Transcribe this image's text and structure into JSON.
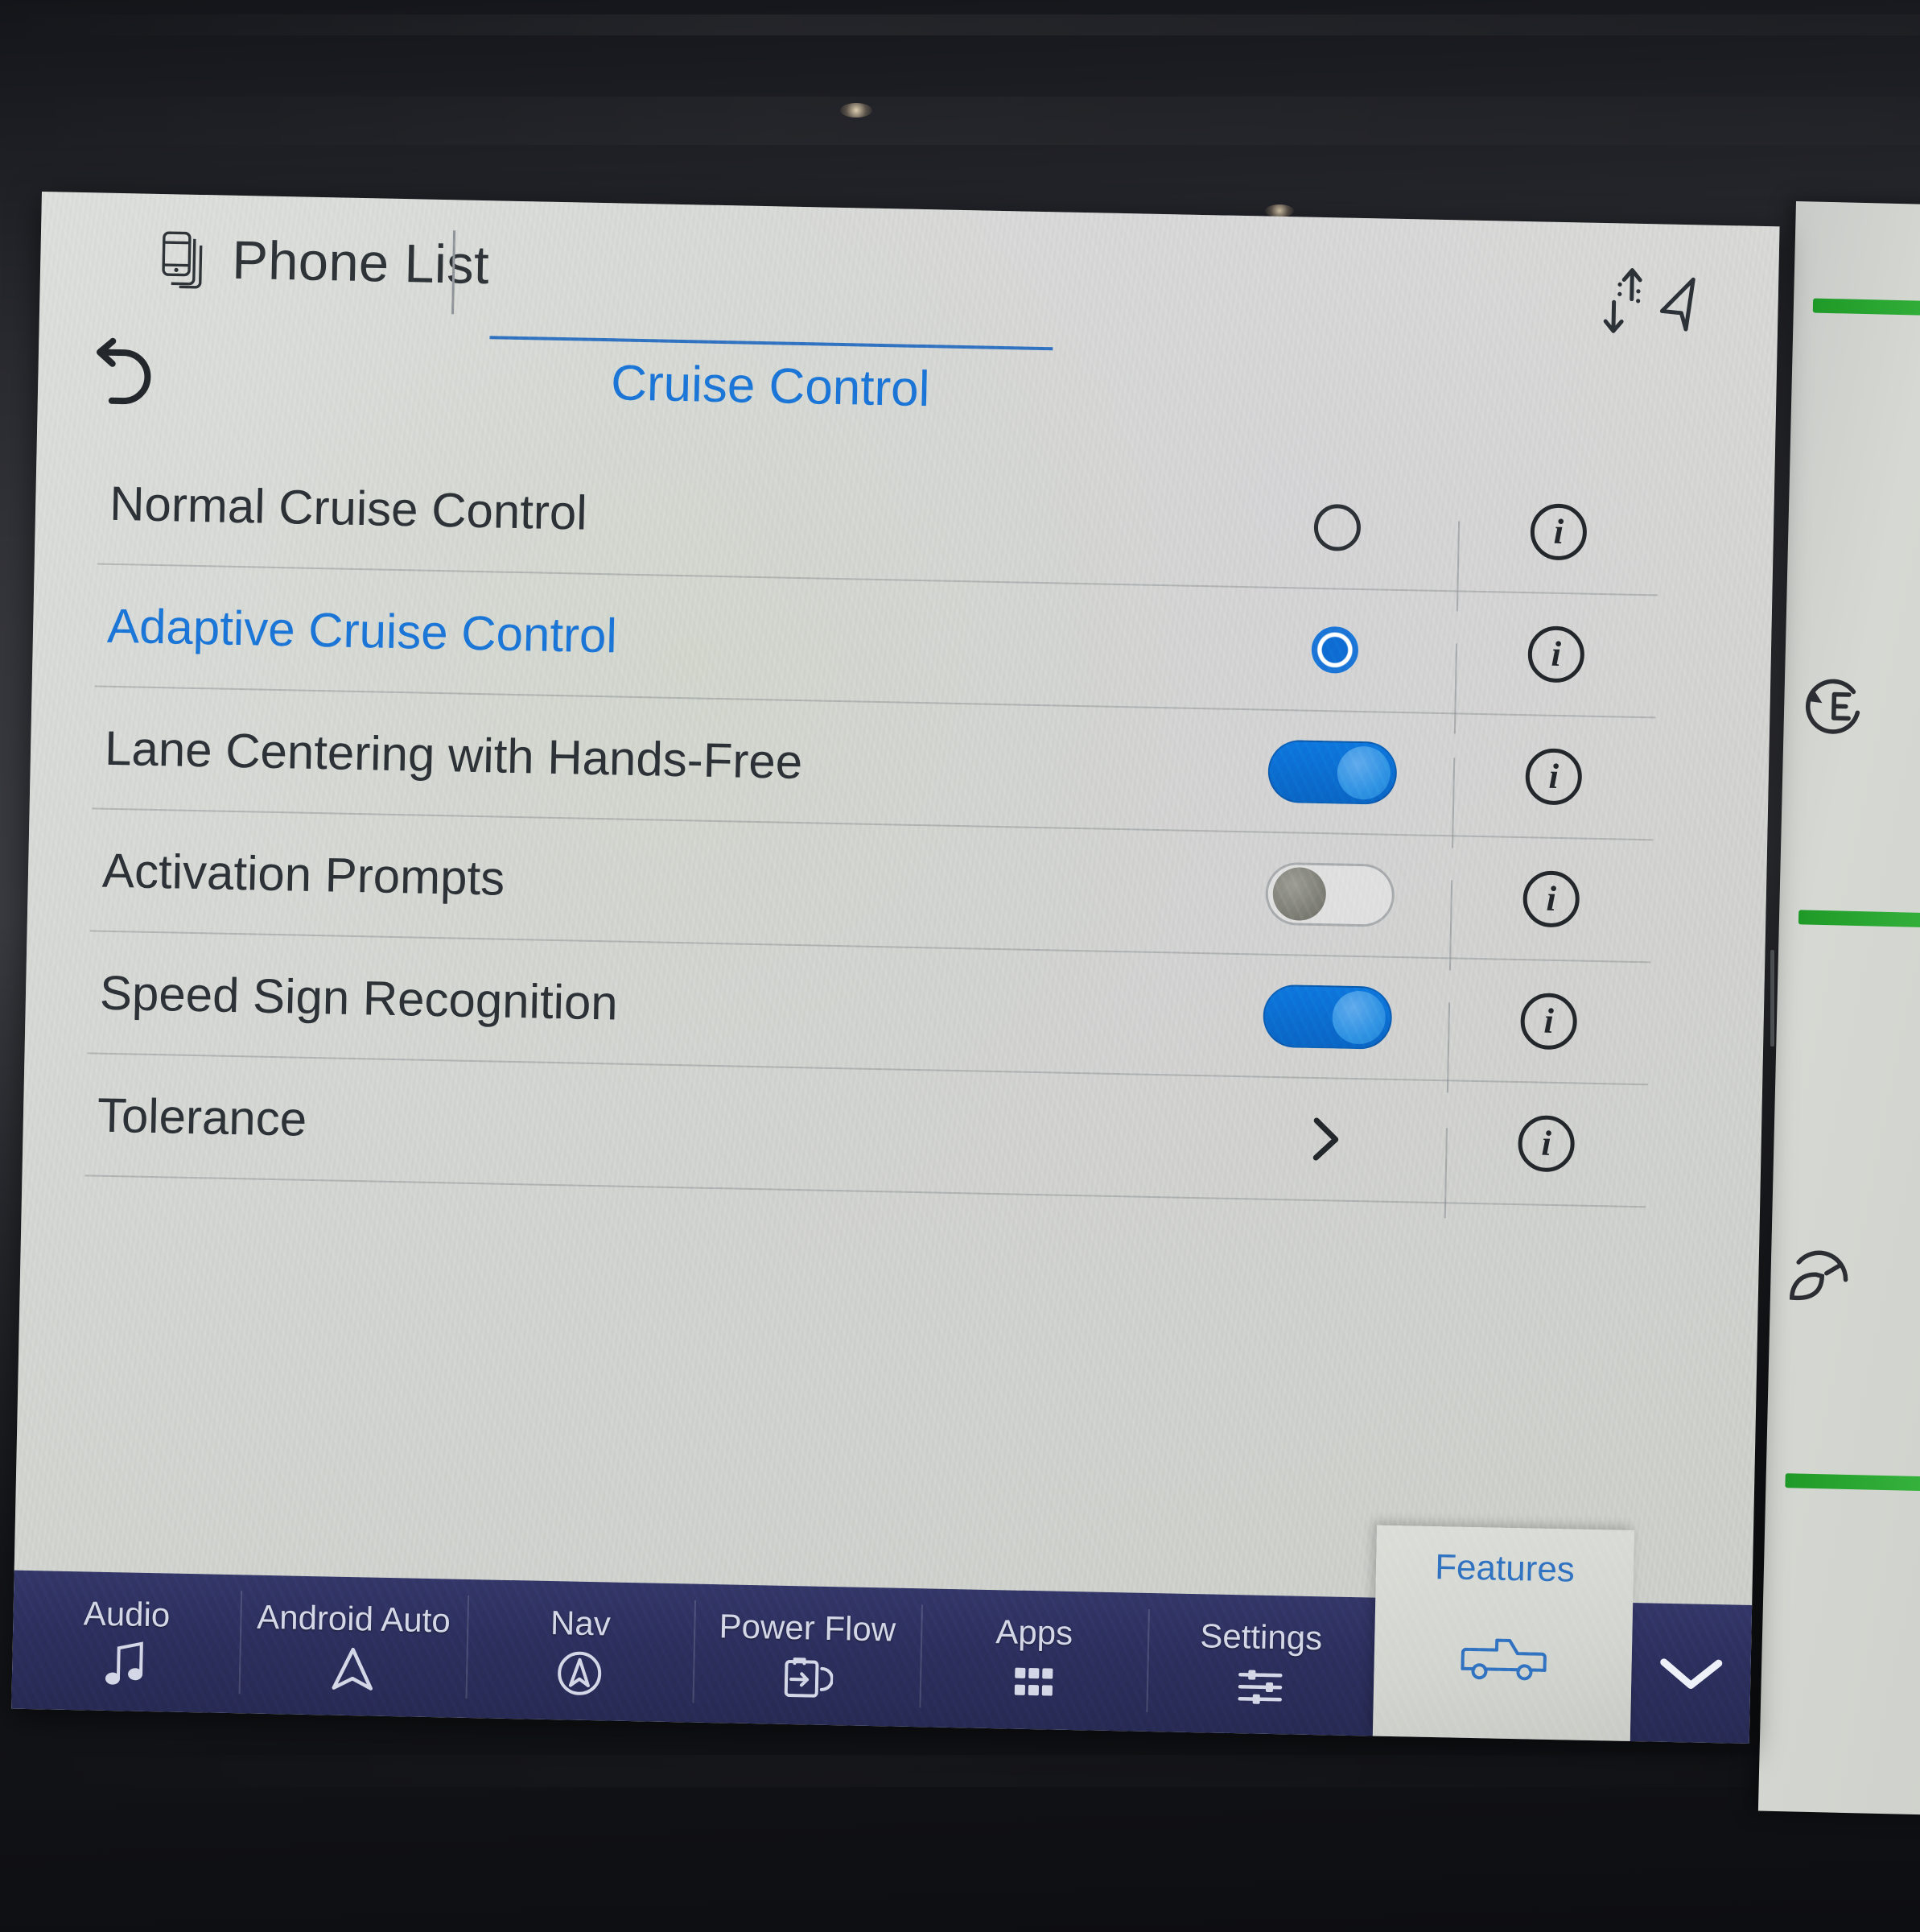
{
  "header": {
    "phone_list_label": "Phone List",
    "phone_icon": "phone-stack-icon",
    "status_icons": [
      "data-transfer-icon",
      "navigation-arrow-icon"
    ]
  },
  "page": {
    "title": "Cruise Control",
    "back_icon": "back-arrow-icon",
    "accent_color": "#1a72d6",
    "text_color": "#2b3036"
  },
  "options": [
    {
      "label": "Normal Cruise Control",
      "control": "radio",
      "state": "off",
      "selected": false,
      "info_icon": "info-icon",
      "info_label": "i"
    },
    {
      "label": "Adaptive Cruise Control",
      "control": "radio",
      "state": "on",
      "selected": true,
      "info_icon": "info-icon",
      "info_label": "i"
    },
    {
      "label": "Lane Centering with Hands-Free",
      "control": "toggle",
      "state": "on",
      "selected": false,
      "info_icon": "info-icon",
      "info_label": "i"
    },
    {
      "label": "Activation Prompts",
      "control": "toggle",
      "state": "off",
      "selected": false,
      "info_icon": "info-icon",
      "info_label": "i"
    },
    {
      "label": "Speed Sign Recognition",
      "control": "toggle",
      "state": "on",
      "selected": false,
      "info_icon": "info-icon",
      "info_label": "i"
    },
    {
      "label": "Tolerance",
      "control": "chevron",
      "state": "",
      "selected": false,
      "info_icon": "info-icon",
      "info_label": "i"
    }
  ],
  "bottom_nav": {
    "background_color": "#2b2e5c",
    "items": [
      {
        "label": "Audio",
        "icon": "music-note-icon"
      },
      {
        "label": "Android Auto",
        "icon": "android-auto-arrow-icon"
      },
      {
        "label": "Nav",
        "icon": "navigation-compass-icon"
      },
      {
        "label": "Power Flow",
        "icon": "power-flow-icon"
      },
      {
        "label": "Apps",
        "icon": "apps-grid-icon"
      },
      {
        "label": "Settings",
        "icon": "sliders-icon"
      }
    ],
    "active_tab": {
      "label": "Features",
      "icon": "pickup-truck-icon"
    },
    "expand_icon": "chevron-down-icon"
  },
  "side_panel": {
    "eco_icons": [
      "eco-regen-icon",
      "eco-leaf-gauge-icon"
    ],
    "bar_color": "#2aa531"
  }
}
